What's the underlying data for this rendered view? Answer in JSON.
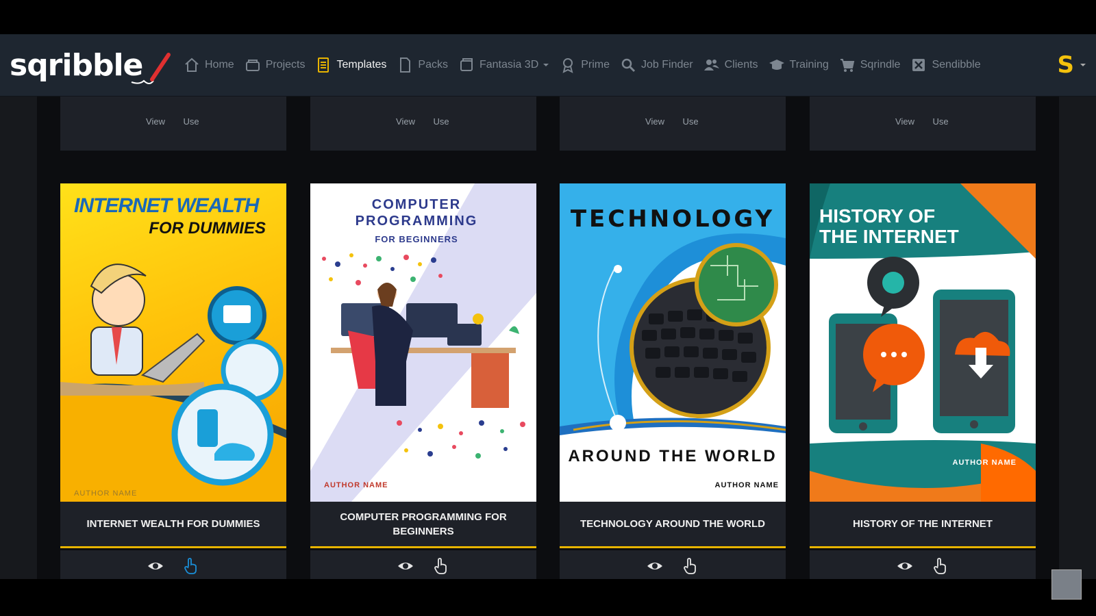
{
  "app": {
    "logo_text": "sqribble",
    "user_initial": "S"
  },
  "nav": {
    "items": [
      {
        "label": "Home",
        "icon": "home-icon"
      },
      {
        "label": "Projects",
        "icon": "projects-icon"
      },
      {
        "label": "Templates",
        "icon": "templates-icon",
        "active": true
      },
      {
        "label": "Packs",
        "icon": "packs-icon"
      },
      {
        "label": "Fantasia 3D",
        "icon": "fantasia-icon"
      },
      {
        "label": "Prime",
        "icon": "prime-icon"
      },
      {
        "label": "Job Finder",
        "icon": "search-icon"
      },
      {
        "label": "Clients",
        "icon": "clients-icon"
      },
      {
        "label": "Training",
        "icon": "training-icon"
      },
      {
        "label": "Sqrindle",
        "icon": "cart-icon"
      },
      {
        "label": "Sendibble",
        "icon": "sendibble-icon"
      }
    ]
  },
  "actions": {
    "view": "View",
    "use": "Use"
  },
  "templates": [
    {
      "title": "INTERNET WEALTH FOR DUMMIES",
      "cover_line1": "INTERNET WEALTH",
      "cover_line2": "FOR DUMMIES",
      "author": "AUTHOR NAME"
    },
    {
      "title": "COMPUTER PROGRAMMING FOR BEGINNERS",
      "cover_line1": "COMPUTER",
      "cover_line2": "PROGRAMMING",
      "cover_line3": "FOR BEGINNERS",
      "author": "AUTHOR NAME"
    },
    {
      "title": "TECHNOLOGY AROUND THE WORLD",
      "cover_line1": "TECHNOLOGY",
      "cover_line2": "AROUND THE WORLD",
      "author": "AUTHOR NAME"
    },
    {
      "title": "HISTORY OF THE INTERNET",
      "cover_line1": "HISTORY OF",
      "cover_line2": "THE INTERNET",
      "author": "AUTHOR NAME"
    }
  ],
  "colors": {
    "accent": "#e8b400",
    "nav_bg": "#1e2630",
    "card_bg": "#1e2128",
    "highlight": "#1a8fd8"
  }
}
